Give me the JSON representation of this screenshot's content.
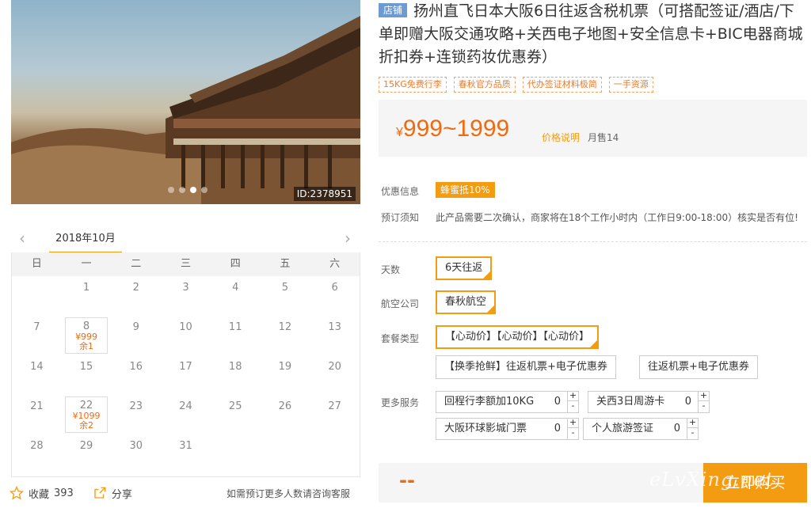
{
  "gallery": {
    "id_label": "ID:2378951"
  },
  "calendar": {
    "month_label": "2018年10月",
    "weekdays": [
      "日",
      "一",
      "二",
      "三",
      "四",
      "五",
      "六"
    ],
    "weeks": [
      [
        {
          "d": ""
        },
        {
          "d": "1"
        },
        {
          "d": "2"
        },
        {
          "d": "3"
        },
        {
          "d": "4"
        },
        {
          "d": "5"
        },
        {
          "d": "6"
        }
      ],
      [
        {
          "d": "7"
        },
        {
          "d": "8",
          "price": "¥999",
          "left": "余1"
        },
        {
          "d": "9"
        },
        {
          "d": "10"
        },
        {
          "d": "11"
        },
        {
          "d": "12"
        },
        {
          "d": "13"
        }
      ],
      [
        {
          "d": "14"
        },
        {
          "d": "15"
        },
        {
          "d": "16"
        },
        {
          "d": "17"
        },
        {
          "d": "18"
        },
        {
          "d": "19"
        },
        {
          "d": "20"
        }
      ],
      [
        {
          "d": "21"
        },
        {
          "d": "22",
          "price": "¥1099",
          "left": "余2"
        },
        {
          "d": "23"
        },
        {
          "d": "24"
        },
        {
          "d": "25"
        },
        {
          "d": "26"
        },
        {
          "d": "27"
        }
      ],
      [
        {
          "d": "28"
        },
        {
          "d": "29"
        },
        {
          "d": "30"
        },
        {
          "d": "31"
        },
        {
          "d": ""
        },
        {
          "d": ""
        },
        {
          "d": ""
        }
      ]
    ]
  },
  "footer": {
    "fav_label": "收藏",
    "fav_count": "393",
    "share_label": "分享",
    "note": "如需预订更多人数请咨询客服"
  },
  "product": {
    "shop_badge": "店铺",
    "title": "扬州直飞日本大阪6日往返含税机票（可搭配签证/酒店/下单即赠大阪交通攻略+关西电子地图+安全信息卡+BIC电器商城折扣券+连锁药妆优惠券）",
    "tags": [
      "15KG免费行李",
      "春秋官方品质",
      "代办签证材料极简",
      "一手资源"
    ],
    "price_symbol": "¥",
    "price_range": "999~1999",
    "price_note": "价格说明",
    "monthly_sales": "月售14"
  },
  "info": {
    "promo_label": "优惠信息",
    "promo_badge": "蜂蜜抵10%",
    "notice_label": "预订须知",
    "notice_text": "此产品需要二次确认，商家将在18个工作小时内（工作日9:00-18:00）核实是否有位!"
  },
  "options": {
    "days_label": "天数",
    "days_value": "6天往返",
    "airline_label": "航空公司",
    "airline_value": "春秋航空",
    "package_label": "套餐类型",
    "packages": [
      "【心动价】【心动价】【心动价】",
      "【换季抢鲜】往返机票+电子优惠券",
      "往返机票+电子优惠券"
    ]
  },
  "services": {
    "label": "更多服务",
    "items": [
      {
        "name": "回程行李额加10KG",
        "qty": "0"
      },
      {
        "name": "关西3日周游卡",
        "qty": "0"
      },
      {
        "name": "大阪环球影城门票",
        "qty": "0"
      },
      {
        "name": "个人旅游签证",
        "qty": "0"
      }
    ],
    "plus": "+",
    "minus": "-"
  },
  "purchase": {
    "total": "--",
    "buy_label": "立即购买"
  },
  "watermark": "eLvXing.net",
  "colors": {
    "accent": "#f39c12",
    "price": "#f06a0f",
    "shop": "#6b9bd1"
  }
}
